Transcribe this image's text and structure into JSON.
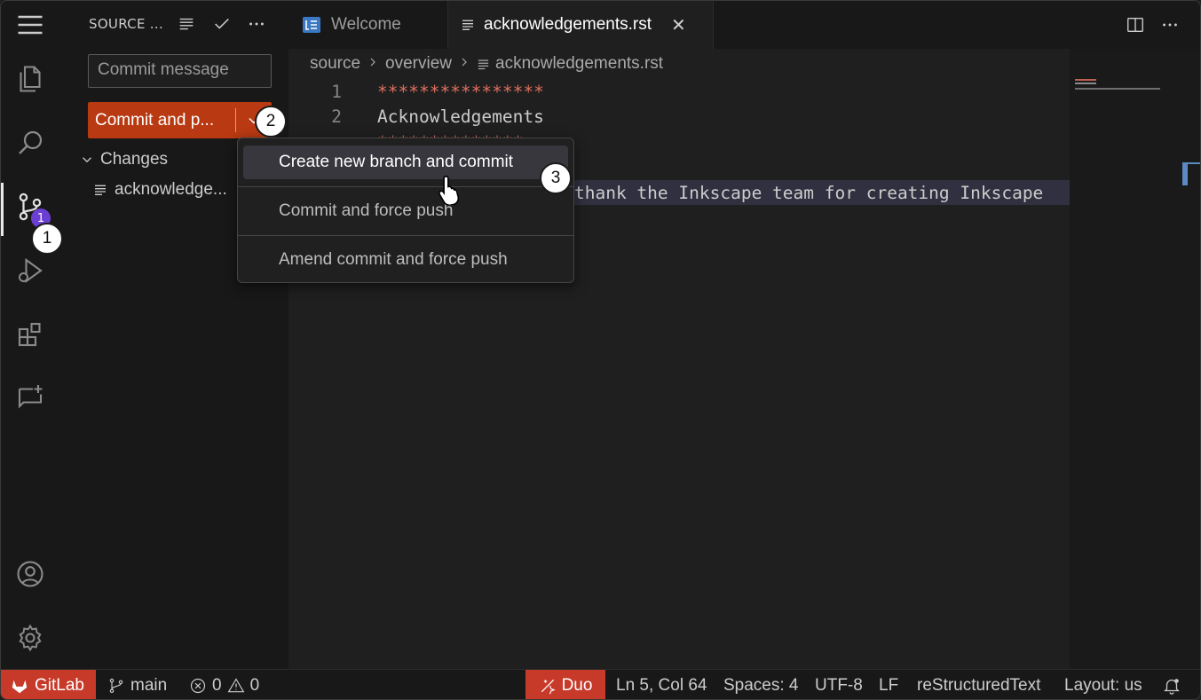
{
  "sidebar": {
    "title": "SOURCE ...",
    "commit_placeholder": "Commit message",
    "commit_button": "Commit and p...",
    "changes_header": "Changes",
    "change_file": "acknowledge..."
  },
  "activity": {
    "scm_badge": "1"
  },
  "steps": [
    "1",
    "2",
    "3"
  ],
  "tabs": [
    {
      "label": "Welcome",
      "active": false
    },
    {
      "label": "acknowledgements.rst",
      "active": true,
      "close": "✕"
    }
  ],
  "breadcrumb": [
    "source",
    "overview",
    "acknowledgements.rst"
  ],
  "editor": {
    "lines": [
      {
        "num": "1",
        "text": "****************"
      },
      {
        "num": "2",
        "text": "Acknowledgements"
      }
    ],
    "visible_fragment": "thank the Inkscape team for creating Inkscape"
  },
  "menu": {
    "items": [
      "Create new branch and commit",
      "Commit and force push",
      "Amend commit and force push"
    ]
  },
  "statusbar": {
    "gitlab": "GitLab",
    "branch": "main",
    "errors": "0",
    "warnings": "0",
    "duo": "Duo",
    "position": "Ln 5, Col 64",
    "spaces": "Spaces: 4",
    "encoding": "UTF-8",
    "eol": "LF",
    "language": "reStructuredText",
    "layout": "Layout: us"
  },
  "colors": {
    "accent_commit": "#b93a12",
    "gitlab_red": "#c73a2a",
    "badge": "#6b3fd1"
  }
}
